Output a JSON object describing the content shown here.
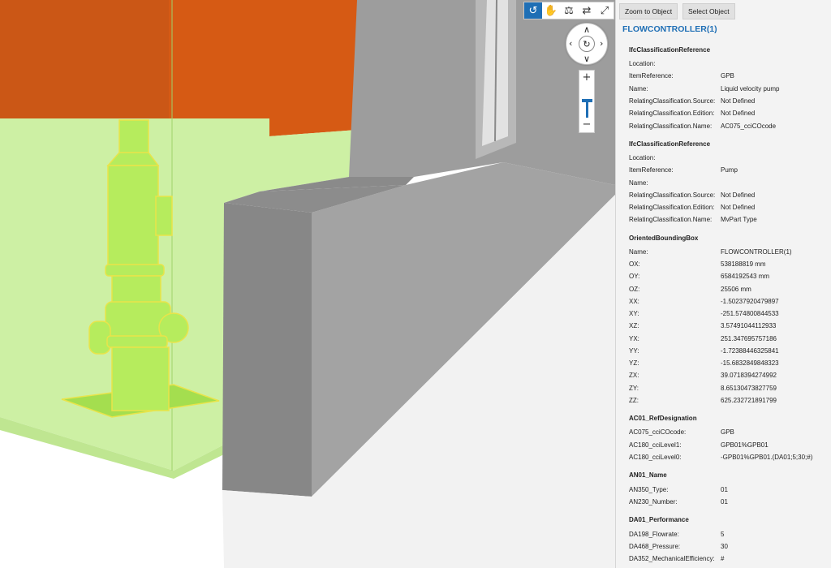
{
  "toolbar": {
    "icons": [
      "orbit-icon",
      "pan-hand-icon",
      "walk-icon",
      "swap-icon",
      "fullscreen-icon"
    ],
    "glyphs": [
      "↺",
      "✋",
      "⚖",
      "⇄",
      "⤢"
    ]
  },
  "nav": {
    "up": "∧",
    "down": "∨",
    "left": "‹",
    "right": "›",
    "center": "↻"
  },
  "zoom": {
    "plus": "+",
    "minus": "−",
    "level": 0.55
  },
  "panel": {
    "zoom_button": "Zoom to Object",
    "select_button": "Select Object",
    "title": "FLOWCONTROLLER(1)",
    "sections": [
      {
        "heading": "IfcClassificationReference",
        "rows": [
          {
            "key": "Location:",
            "value": ""
          },
          {
            "key": "ItemReference:",
            "value": "GPB"
          },
          {
            "key": "Name:",
            "value": "Liquid velocity pump"
          },
          {
            "key": "RelatingClassification.Source:",
            "value": " Not Defined"
          },
          {
            "key": "RelatingClassification.Edition:",
            "value": " Not Defined"
          },
          {
            "key": "RelatingClassification.Name:",
            "value": "AC075_cciCOcode"
          }
        ]
      },
      {
        "heading": "IfcClassificationReference",
        "rows": [
          {
            "key": "Location:",
            "value": ""
          },
          {
            "key": "ItemReference:",
            "value": "Pump"
          },
          {
            "key": "Name:",
            "value": ""
          },
          {
            "key": "RelatingClassification.Source:",
            "value": " Not Defined"
          },
          {
            "key": "RelatingClassification.Edition:",
            "value": " Not Defined"
          },
          {
            "key": "RelatingClassification.Name:",
            "value": "MvPart Type"
          }
        ]
      },
      {
        "heading": "OrientedBoundingBox",
        "rows": [
          {
            "key": "Name:",
            "value": "FLOWCONTROLLER(1)"
          },
          {
            "key": "OX:",
            "value": "538188819 mm"
          },
          {
            "key": "OY:",
            "value": "6584192543 mm"
          },
          {
            "key": "OZ:",
            "value": "25506 mm"
          },
          {
            "key": "XX:",
            "value": "-1.50237920479897"
          },
          {
            "key": "XY:",
            "value": "-251.574800844533"
          },
          {
            "key": "XZ:",
            "value": "3.57491044112933"
          },
          {
            "key": "YX:",
            "value": "251.347695757186"
          },
          {
            "key": "YY:",
            "value": "-1.72388446325841"
          },
          {
            "key": "YZ:",
            "value": "-15.6832849848323"
          },
          {
            "key": "ZX:",
            "value": "39.0718394274992"
          },
          {
            "key": "ZY:",
            "value": "8.65130473827759"
          },
          {
            "key": "ZZ:",
            "value": "625.232721891799"
          }
        ]
      },
      {
        "heading": "AC01_RefDesignation",
        "rows": [
          {
            "key": "AC075_cciCOcode:",
            "value": "GPB"
          },
          {
            "key": "AC180_cciLevel1:",
            "value": "GPB01%GPB01"
          },
          {
            "key": "AC180_cciLevel0:",
            "value": "-GPB01%GPB01.(DA01;5;30;#)"
          }
        ]
      },
      {
        "heading": "AN01_Name",
        "rows": [
          {
            "key": "AN350_Type:",
            "value": "01"
          },
          {
            "key": "AN230_Number:",
            "value": "01"
          }
        ]
      },
      {
        "heading": "DA01_Performance",
        "rows": [
          {
            "key": "DA198_Flowrate:",
            "value": "5"
          },
          {
            "key": "DA468_Pressure:",
            "value": "30"
          },
          {
            "key": "DA352_MechanicalEfficiency:",
            "value": "#"
          }
        ]
      }
    ]
  }
}
